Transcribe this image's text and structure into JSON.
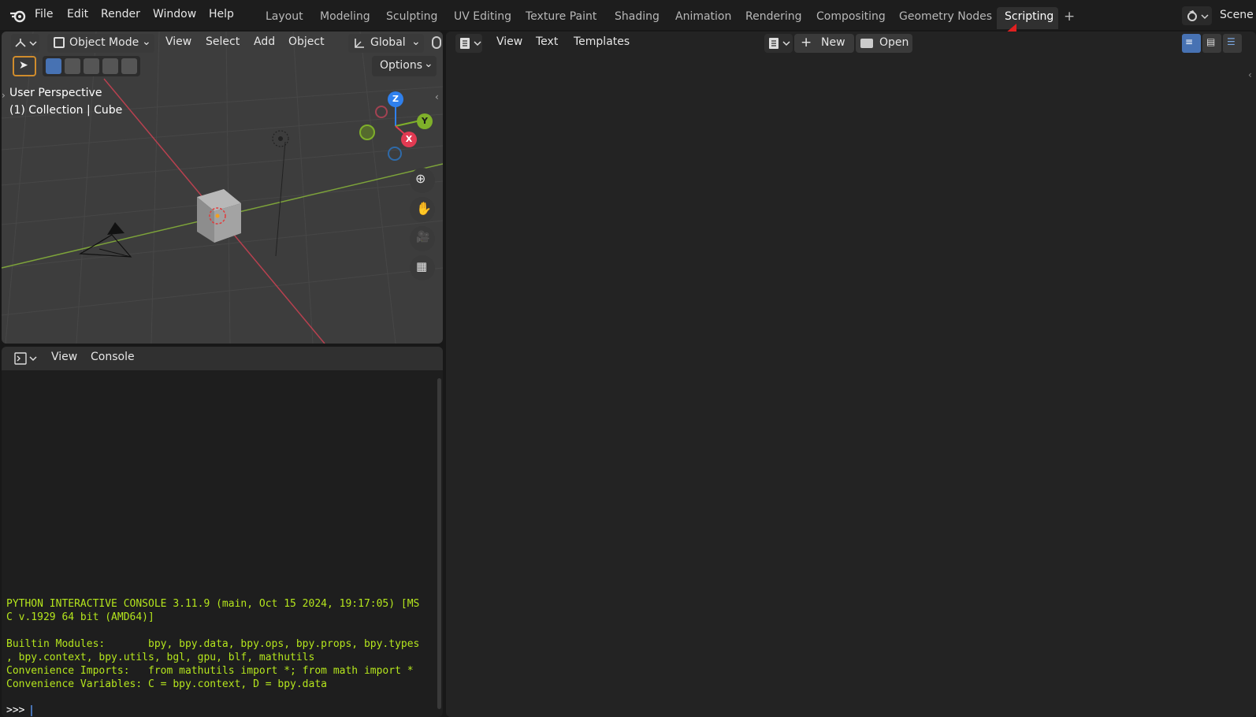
{
  "topbar": {
    "menu": [
      "File",
      "Edit",
      "Render",
      "Window",
      "Help"
    ],
    "workspaces": [
      "Layout",
      "Modeling",
      "Sculpting",
      "UV Editing",
      "Texture Paint",
      "Shading",
      "Animation",
      "Rendering",
      "Compositing",
      "Geometry Nodes",
      "Scripting"
    ],
    "add_tab": "+",
    "scene_label": "Scene"
  },
  "viewport": {
    "mode": "Object Mode",
    "menus": [
      "View",
      "Select",
      "Add",
      "Object"
    ],
    "orientation": "Global",
    "options": "Options",
    "overlay_line1": "User Perspective",
    "overlay_line2": "(1) Collection | Cube",
    "axes": {
      "z": "Z",
      "y": "Y",
      "x": "X"
    }
  },
  "console": {
    "menus": [
      "View",
      "Console"
    ],
    "lines": [
      "PYTHON INTERACTIVE CONSOLE 3.11.9 (main, Oct 15 2024, 19:17:05) [MS",
      "C v.1929 64 bit (AMD64)]",
      "",
      "Builtin Modules:       bpy, bpy.data, bpy.ops, bpy.props, bpy.types",
      ", bpy.context, bpy.utils, bgl, gpu, blf, mathutils",
      "Convenience Imports:   from mathutils import *; from math import *",
      "Convenience Variables: C = bpy.context, D = bpy.data"
    ],
    "prompt": ">>> "
  },
  "text_editor": {
    "menus": [
      "View",
      "Text",
      "Templates"
    ],
    "new_label": "New",
    "open_label": "Open"
  },
  "colors": {
    "accent_blue": "#4772b3",
    "console_green": "#b5e61d",
    "axis_x": "#e23a52",
    "axis_y": "#7fb02a",
    "axis_z": "#2f80ed",
    "annotation_arrow": "#e02020"
  }
}
